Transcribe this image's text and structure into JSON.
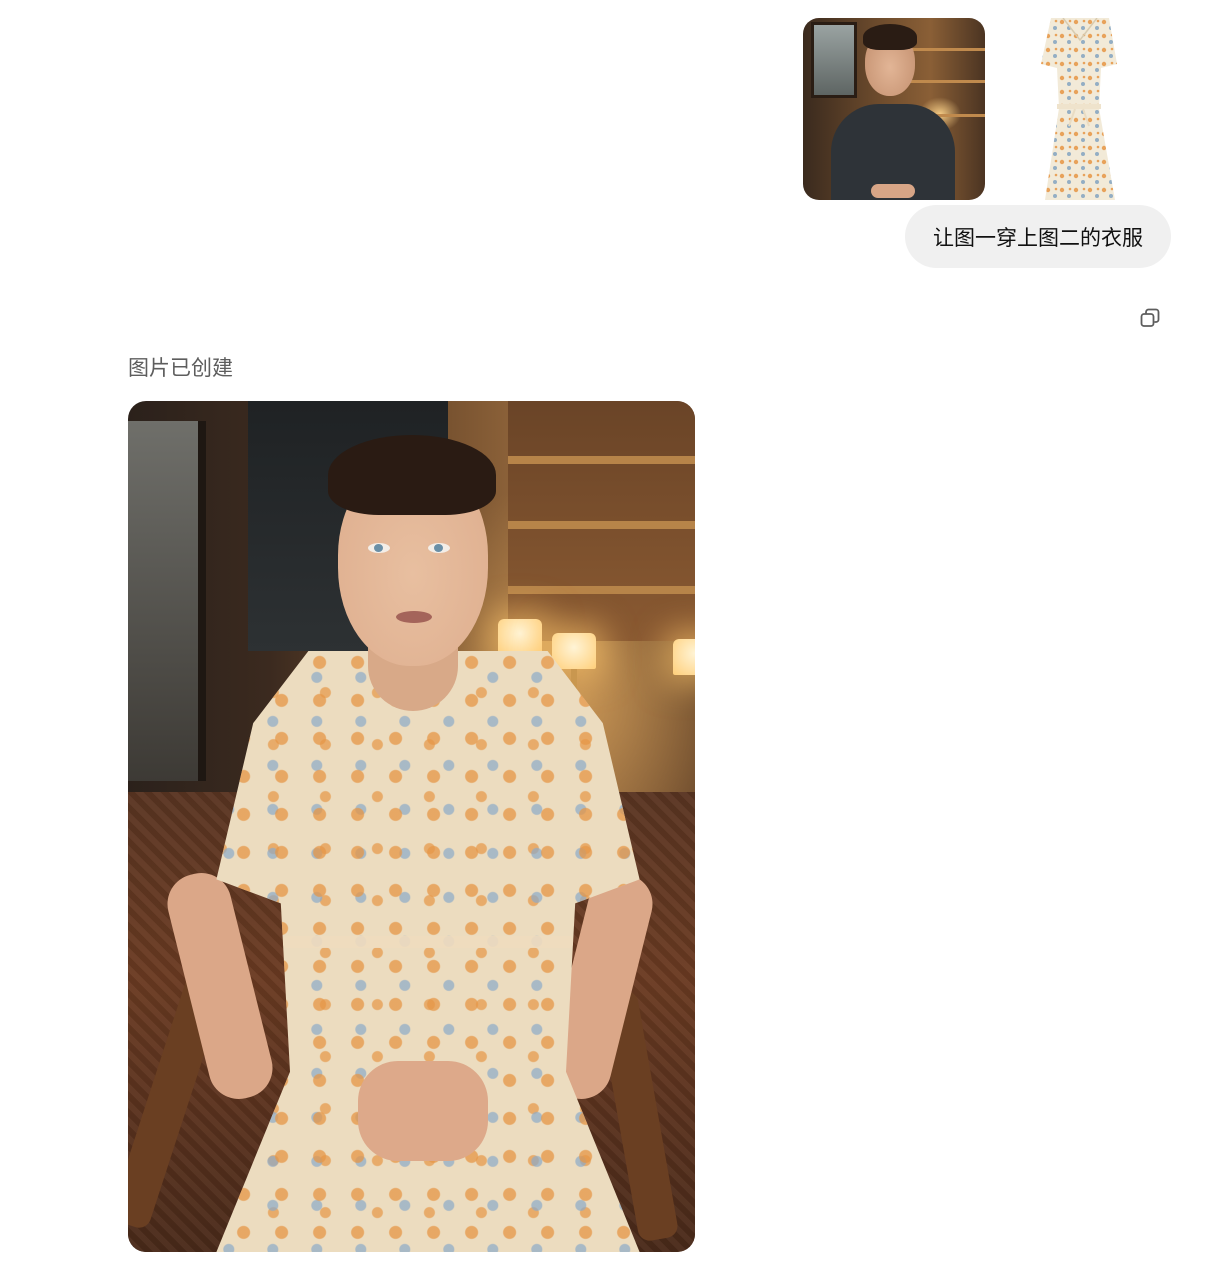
{
  "user_message": {
    "text": "让图一穿上图二的衣服",
    "attachments": [
      {
        "kind": "image",
        "name": "person-photo"
      },
      {
        "kind": "image",
        "name": "floral-dress-photo"
      }
    ]
  },
  "assistant": {
    "status": "图片已创建",
    "image": {
      "kind": "generated-image"
    }
  },
  "icons": {
    "copy": "copy-icon"
  },
  "colors": {
    "bubble_bg": "#f0f0f0",
    "status_text": "#5d5d5d"
  }
}
